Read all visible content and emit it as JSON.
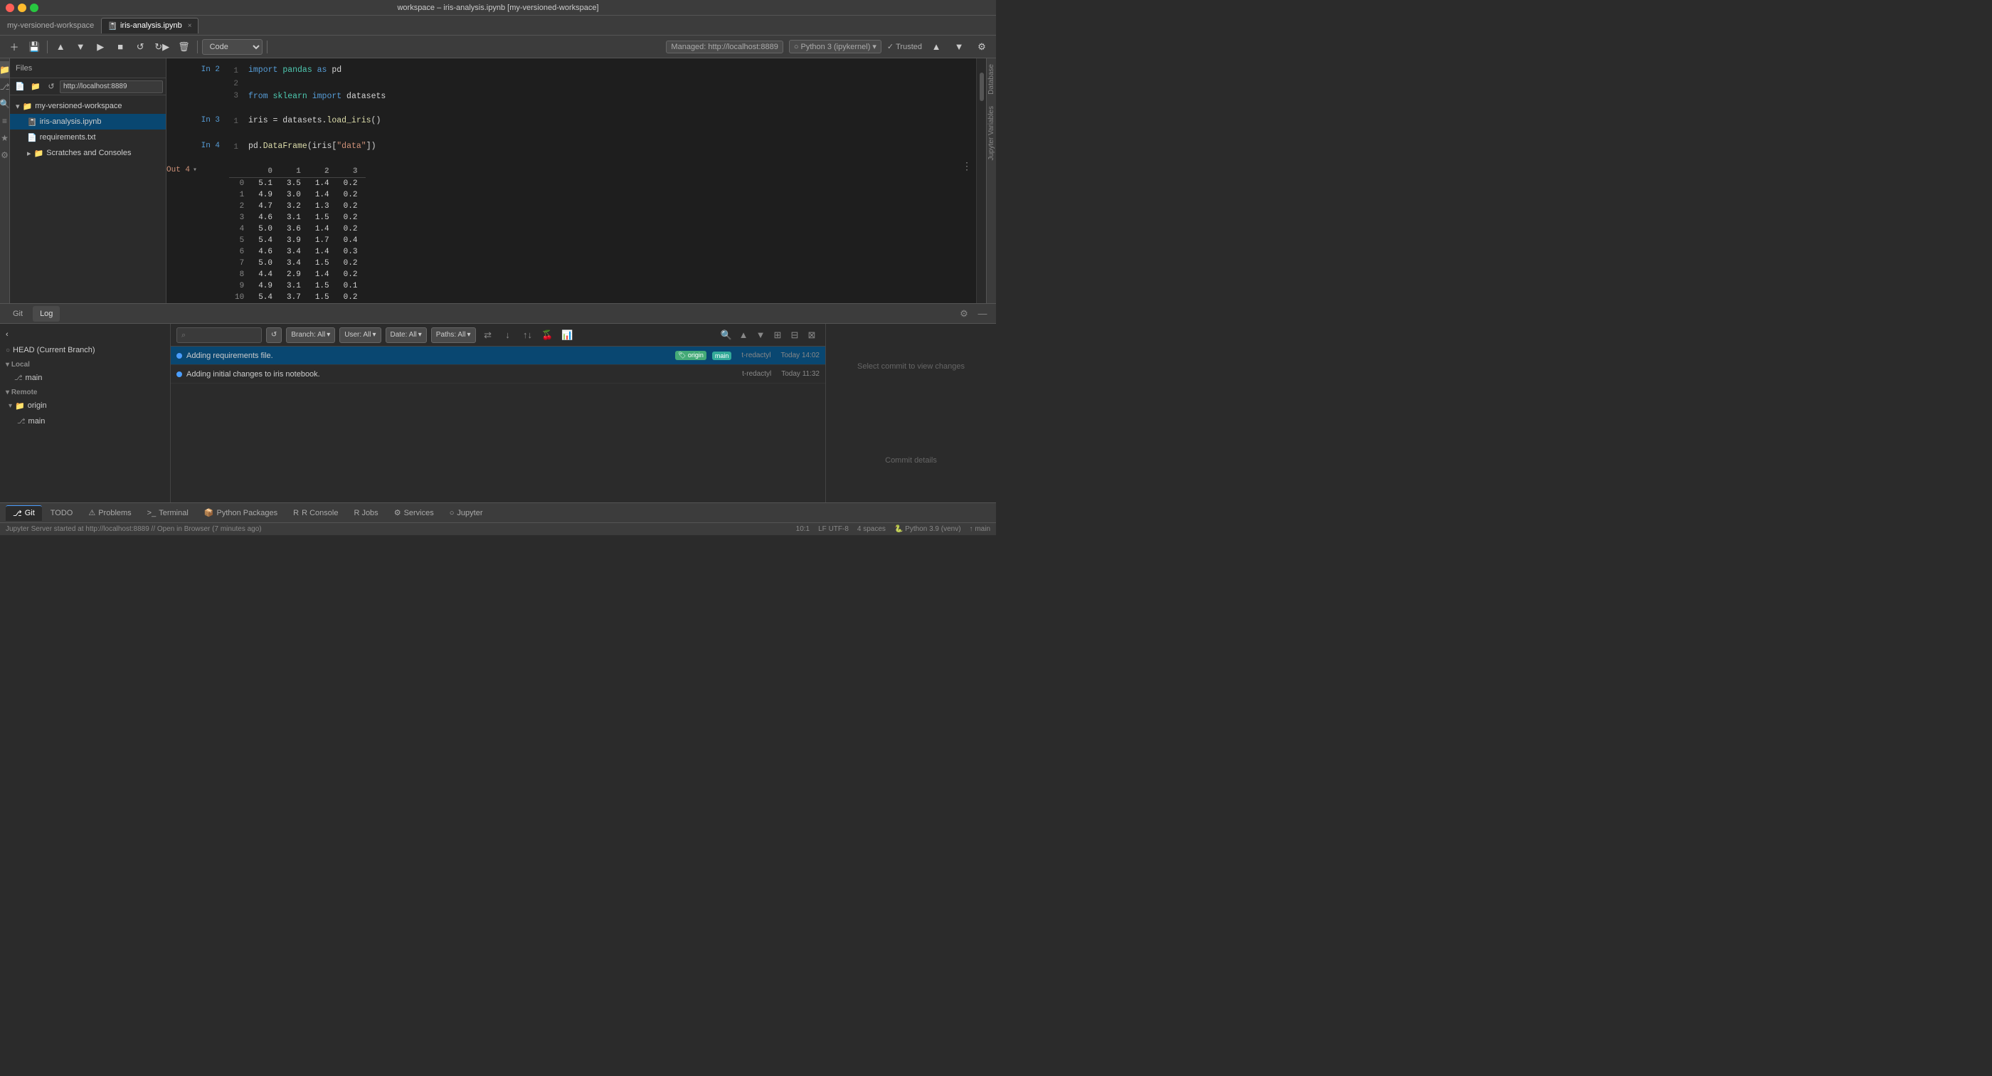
{
  "window": {
    "title": "workspace – iris-analysis.ipynb [my-versioned-workspace]",
    "controls": [
      "close",
      "minimize",
      "maximize"
    ]
  },
  "tabs": {
    "project": "my-versioned-workspace",
    "url": "http://localhost:8889",
    "active_file": "iris-analysis.ipynb"
  },
  "toolbar": {
    "cell_type": "Code",
    "server": "Managed: http://localhost:8889",
    "kernel": "Python 3 (ipykernel)",
    "trusted": "Trusted"
  },
  "file_tree": {
    "root": "my-versioned-workspace",
    "url": "http://localhost:8889",
    "items": [
      {
        "name": "iris-analysis.ipynb",
        "type": "notebook",
        "active": true,
        "indent": 1
      },
      {
        "name": "requirements.txt",
        "type": "file",
        "active": false,
        "indent": 1
      },
      {
        "name": "Scratches and Consoles",
        "type": "folder",
        "active": false,
        "indent": 1
      }
    ]
  },
  "cells": [
    {
      "id": "cell-2",
      "prompt_in": "In 2",
      "lines": [
        1,
        2,
        3
      ],
      "code": [
        "import pandas as pd",
        "",
        "from sklearn import datasets"
      ],
      "code_html": true
    },
    {
      "id": "cell-3",
      "prompt_in": "In 3",
      "lines": [
        1
      ],
      "code": [
        "iris = datasets.load_iris()"
      ]
    },
    {
      "id": "cell-4",
      "prompt_in": "In 4",
      "lines": [
        1
      ],
      "code": [
        "pd.DataFrame(iris[\"data\"])"
      ]
    }
  ],
  "dataframe": {
    "prompt_out": "Out 4",
    "columns": [
      "",
      "0",
      "1",
      "2",
      "3"
    ],
    "rows": [
      [
        "0",
        "5.1",
        "3.5",
        "1.4",
        "0.2"
      ],
      [
        "1",
        "4.9",
        "3.0",
        "1.4",
        "0.2"
      ],
      [
        "2",
        "4.7",
        "3.2",
        "1.3",
        "0.2"
      ],
      [
        "3",
        "4.6",
        "3.1",
        "1.5",
        "0.2"
      ],
      [
        "4",
        "5.0",
        "3.6",
        "1.4",
        "0.2"
      ],
      [
        "5",
        "5.4",
        "3.9",
        "1.7",
        "0.4"
      ],
      [
        "6",
        "4.6",
        "3.4",
        "1.4",
        "0.3"
      ],
      [
        "7",
        "5.0",
        "3.4",
        "1.5",
        "0.2"
      ],
      [
        "8",
        "4.4",
        "2.9",
        "1.4",
        "0.2"
      ],
      [
        "9",
        "4.9",
        "3.1",
        "1.5",
        "0.1"
      ],
      [
        "10",
        "5.4",
        "3.7",
        "1.5",
        "0.2"
      ]
    ]
  },
  "git": {
    "tabs": [
      "Git",
      "Log"
    ],
    "active_tab": "Log",
    "branches": {
      "head": "HEAD (Current Branch)",
      "local": {
        "label": "Local",
        "items": [
          "main"
        ]
      },
      "remote": {
        "label": "Remote",
        "items": [
          {
            "name": "origin",
            "children": [
              "main"
            ]
          }
        ]
      }
    },
    "commits": [
      {
        "message": "Adding requirements file.",
        "badges": [
          "origin",
          "main"
        ],
        "author": "t-redactyl",
        "time": "Today 14:02",
        "selected": true
      },
      {
        "message": "Adding initial changes to iris notebook.",
        "badges": [],
        "author": "t-redactyl",
        "time": "Today 11:32",
        "selected": false
      }
    ],
    "commit_detail_placeholder": "Select commit to view changes",
    "commit_details_placeholder": "Commit details"
  },
  "bottom_tabs": [
    {
      "label": "Git",
      "icon": "⎇",
      "active": true
    },
    {
      "label": "TODO",
      "icon": "",
      "active": false
    },
    {
      "label": "Problems",
      "icon": "⚠",
      "active": false
    },
    {
      "label": "Terminal",
      "icon": ">_",
      "active": false
    },
    {
      "label": "Python Packages",
      "icon": "📦",
      "active": false
    },
    {
      "label": "R Console",
      "icon": "R",
      "active": false
    },
    {
      "label": "R Jobs",
      "icon": "",
      "active": false
    },
    {
      "label": "Services",
      "icon": "⚙",
      "active": false
    },
    {
      "label": "Jupyter",
      "icon": "○",
      "active": false
    }
  ],
  "statusbar": {
    "line_col": "10:1",
    "encoding": "LF  UTF-8",
    "indent": "4 spaces",
    "python": "🐍 Python 3.9 (venv)",
    "branch": "↑ main",
    "jupyter_status": "Jupyter Server started at http://localhost:8889 // Open in Browser (7 minutes ago)"
  }
}
